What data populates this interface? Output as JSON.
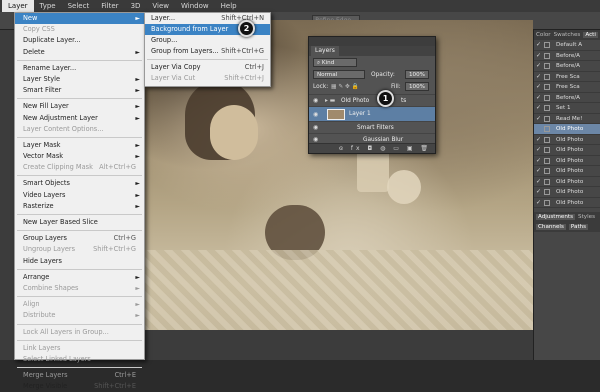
{
  "menubar": {
    "items": [
      "Layer",
      "Type",
      "Select",
      "Filter",
      "3D",
      "View",
      "Window",
      "Help"
    ]
  },
  "optbar": {
    "refine_edge": "Refine Edge..."
  },
  "layer_menu": {
    "items": [
      {
        "label": "New",
        "submenu": true,
        "highlight": true
      },
      {
        "label": "Copy CSS",
        "disabled": true
      },
      {
        "label": "Duplicate Layer..."
      },
      {
        "label": "Delete",
        "submenu": true
      },
      {
        "sep": true
      },
      {
        "label": "Rename Layer..."
      },
      {
        "label": "Layer Style",
        "submenu": true
      },
      {
        "label": "Smart Filter",
        "submenu": true
      },
      {
        "sep": true
      },
      {
        "label": "New Fill Layer",
        "submenu": true
      },
      {
        "label": "New Adjustment Layer",
        "submenu": true
      },
      {
        "label": "Layer Content Options...",
        "disabled": true
      },
      {
        "sep": true
      },
      {
        "label": "Layer Mask",
        "submenu": true
      },
      {
        "label": "Vector Mask",
        "submenu": true
      },
      {
        "label": "Create Clipping Mask",
        "shortcut": "Alt+Ctrl+G",
        "disabled": true
      },
      {
        "sep": true
      },
      {
        "label": "Smart Objects",
        "submenu": true
      },
      {
        "label": "Video Layers",
        "submenu": true
      },
      {
        "label": "Rasterize",
        "submenu": true
      },
      {
        "sep": true
      },
      {
        "label": "New Layer Based Slice"
      },
      {
        "sep": true
      },
      {
        "label": "Group Layers",
        "shortcut": "Ctrl+G"
      },
      {
        "label": "Ungroup Layers",
        "shortcut": "Shift+Ctrl+G",
        "disabled": true
      },
      {
        "label": "Hide Layers"
      },
      {
        "sep": true
      },
      {
        "label": "Arrange",
        "submenu": true
      },
      {
        "label": "Combine Shapes",
        "submenu": true,
        "disabled": true
      },
      {
        "sep": true
      },
      {
        "label": "Align",
        "submenu": true,
        "disabled": true
      },
      {
        "label": "Distribute",
        "submenu": true,
        "disabled": true
      },
      {
        "sep": true
      },
      {
        "label": "Lock All Layers in Group...",
        "disabled": true
      },
      {
        "sep": true
      },
      {
        "label": "Link Layers",
        "disabled": true
      },
      {
        "label": "Select Linked Layers",
        "disabled": true
      },
      {
        "sep": true
      },
      {
        "label": "Merge Layers",
        "shortcut": "Ctrl+E",
        "disabled": true
      },
      {
        "label": "Merge Visible",
        "shortcut": "Shift+Ctrl+E"
      }
    ]
  },
  "new_submenu": {
    "items": [
      {
        "label": "Layer...",
        "shortcut": "Shift+Ctrl+N"
      },
      {
        "label": "Background from Layer",
        "highlight": true
      },
      {
        "label": "Group..."
      },
      {
        "label": "Group from Layers...",
        "shortcut": "Shift+Ctrl+G"
      },
      {
        "sep": true
      },
      {
        "label": "Layer Via Copy",
        "shortcut": "Ctrl+J"
      },
      {
        "label": "Layer Via Cut",
        "shortcut": "Shift+Ctrl+J",
        "disabled": true
      }
    ]
  },
  "badges": {
    "one": "1",
    "two": "2"
  },
  "layers_panel": {
    "tab": "Layers",
    "kind": "Kind",
    "blend_mode": "Normal",
    "opacity_label": "Opacity:",
    "opacity_value": "100%",
    "lock_label": "Lock:",
    "fill_label": "Fill:",
    "fill_value": "100%",
    "rows": [
      {
        "label": "Old Photo",
        "extra": "ts"
      },
      {
        "label": "Layer 1",
        "selected": true
      },
      {
        "label": "Smart Filters"
      },
      {
        "label": "Gaussian Blur"
      }
    ],
    "footer_icons": "ɞ fx ◘ ◍ ▭ ▣ 🗑"
  },
  "dock": {
    "tabs": [
      "Color",
      "Swatches",
      "Acti"
    ],
    "actions": [
      {
        "label": "Default A",
        "check": true
      },
      {
        "label": "Before/A",
        "check": true
      },
      {
        "label": "Before/A",
        "check": true
      },
      {
        "label": "Free Sca",
        "check": true
      },
      {
        "label": "Free Sca",
        "check": true
      },
      {
        "label": "Before/A",
        "check": true
      },
      {
        "label": "Set 1",
        "check": true
      },
      {
        "label": "Read Me!",
        "check": true
      },
      {
        "label": "Old Photo",
        "check": false,
        "highlight": true
      },
      {
        "label": "Old Photo",
        "check": true
      },
      {
        "label": "Old Photo",
        "check": true
      },
      {
        "label": "Old Photo",
        "check": true
      },
      {
        "label": "Old Photo",
        "check": true
      },
      {
        "label": "Old Photo",
        "check": true
      },
      {
        "label": "Old Photo",
        "check": true
      },
      {
        "label": "Old Photo",
        "check": true
      }
    ],
    "bottom_tabs": [
      "Adjustments",
      "Styles"
    ],
    "bottom_tabs2": [
      "Channels",
      "Paths"
    ]
  }
}
